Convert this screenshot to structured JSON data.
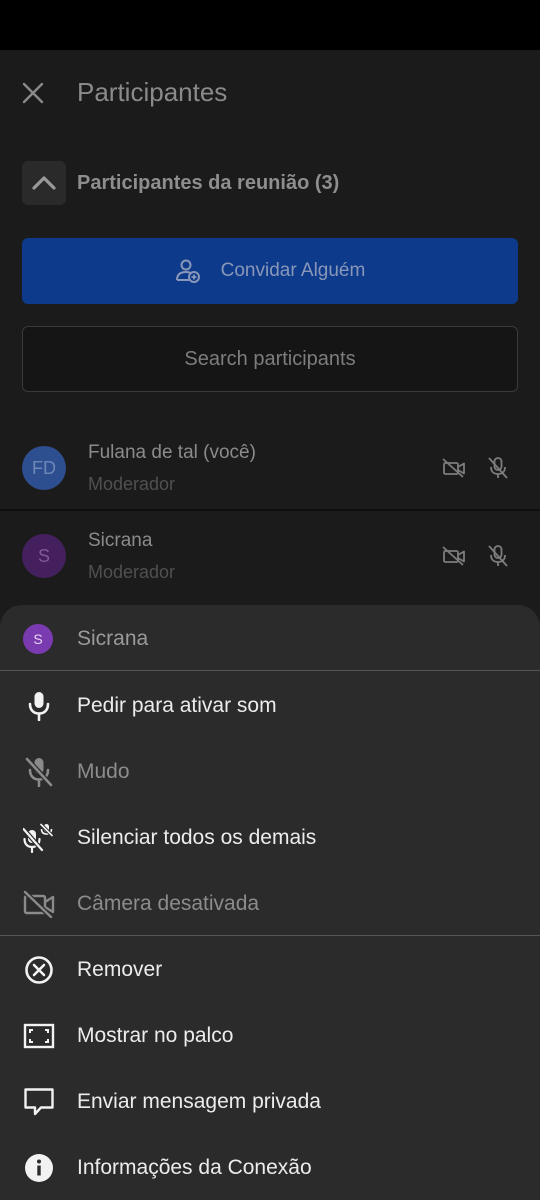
{
  "header": {
    "title": "Participantes"
  },
  "section": {
    "title": "Participantes da reunião (3)"
  },
  "invite": {
    "label": "Convidar Alguém"
  },
  "search": {
    "placeholder": "Search participants"
  },
  "participants": [
    {
      "initials": "FD",
      "name": "Fulana de tal (você)",
      "role": "Moderador",
      "avatar_color": "#2e4f8f"
    },
    {
      "initials": "S",
      "name": "Sicrana",
      "role": "Moderador",
      "avatar_color": "#45205e"
    }
  ],
  "sheet": {
    "initial": "S",
    "name": "Sicrana",
    "avatar_color": "#7a3ab0",
    "items": [
      {
        "label": "Pedir para ativar som",
        "icon": "microphone-icon",
        "enabled": true
      },
      {
        "label": "Mudo",
        "icon": "mic-off-icon",
        "enabled": false
      },
      {
        "label": "Silenciar todos os demais",
        "icon": "mute-everyone-icon",
        "enabled": true
      },
      {
        "label": "Câmera desativada",
        "icon": "camera-off-icon",
        "enabled": false
      },
      {
        "label": "Remover",
        "icon": "remove-circle-icon",
        "enabled": true
      },
      {
        "label": "Mostrar no palco",
        "icon": "stage-frame-icon",
        "enabled": true
      },
      {
        "label": "Enviar mensagem privada",
        "icon": "chat-bubble-icon",
        "enabled": true
      },
      {
        "label": "Informações da Conexão",
        "icon": "info-icon",
        "enabled": true
      }
    ]
  },
  "colors": {
    "invite_bg": "#0e3a8c",
    "panel_bg": "#1b1b1b",
    "sheet_bg": "#2b2b2b"
  }
}
